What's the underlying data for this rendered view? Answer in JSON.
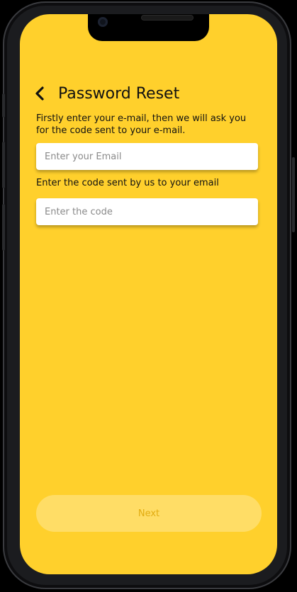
{
  "header": {
    "back_icon": "chevron-left-icon",
    "title": "Password Reset"
  },
  "instructions": {
    "text": "Firstly enter your e-mail, then we will ask you for the code sent to your e-mail."
  },
  "email_field": {
    "value": "",
    "placeholder": "Enter your Email"
  },
  "code_section": {
    "label": "Enter the code sent by us to your email",
    "value": "",
    "placeholder": "Enter the code"
  },
  "footer": {
    "next_label": "Next"
  },
  "colors": {
    "screen_background": "#ffd02c",
    "button_background": "#ffdd66",
    "button_text": "#e2ac11",
    "text": "#111111"
  }
}
